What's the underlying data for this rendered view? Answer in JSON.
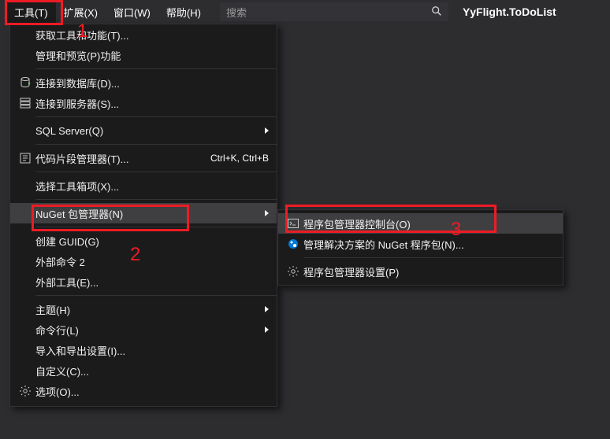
{
  "menubar": {
    "tools": "工具(T)",
    "ext": "扩展(X)",
    "window": "窗口(W)",
    "help": "帮助(H)"
  },
  "search": {
    "placeholder": "搜索"
  },
  "title": "YyFlight.ToDoList",
  "menu": {
    "get_tools": "获取工具和功能(T)...",
    "manage_preview": "管理和预览(P)功能",
    "connect_db": "连接到数据库(D)...",
    "connect_srv": "连接到服务器(S)...",
    "sql_server": "SQL Server(Q)",
    "snippet_mgr": "代码片段管理器(T)...",
    "snippet_keys": "Ctrl+K, Ctrl+B",
    "toolbox": "选择工具箱项(X)...",
    "nuget": "NuGet 包管理器(N)",
    "create_guid": "创建 GUID(G)",
    "ext_cmd": "外部命令 2",
    "ext_tools": "外部工具(E)...",
    "theme": "主题(H)",
    "cmdline": "命令行(L)",
    "import_export": "导入和导出设置(I)...",
    "customize": "自定义(C)...",
    "options": "选项(O)..."
  },
  "submenu": {
    "pm_console": "程序包管理器控制台(O)",
    "manage_sol": "管理解决方案的 NuGet 程序包(N)...",
    "pm_settings": "程序包管理器设置(P)"
  },
  "annot": {
    "n1": "1",
    "n2": "2",
    "n3": "3"
  }
}
